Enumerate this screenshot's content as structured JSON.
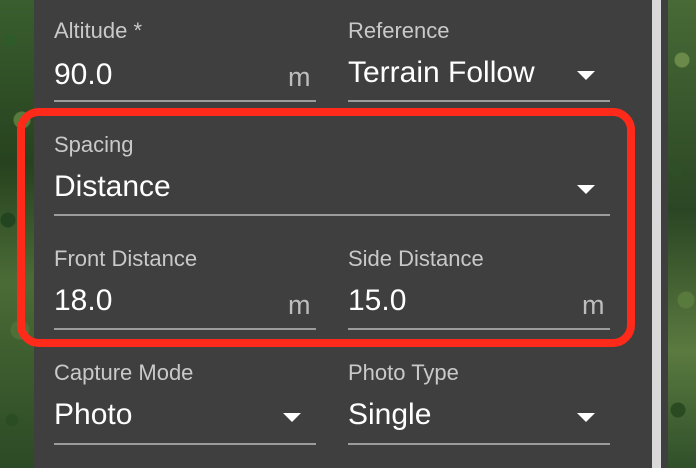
{
  "form": {
    "altitude": {
      "label": "Altitude *",
      "value": "90.0",
      "unit": "m"
    },
    "reference": {
      "label": "Reference",
      "value": "Terrain Follow"
    },
    "spacing": {
      "label": "Spacing",
      "value": "Distance"
    },
    "front_distance": {
      "label": "Front Distance",
      "value": "18.0",
      "unit": "m"
    },
    "side_distance": {
      "label": "Side Distance",
      "value": "15.0",
      "unit": "m"
    },
    "capture_mode": {
      "label": "Capture Mode",
      "value": "Photo"
    },
    "photo_type": {
      "label": "Photo Type",
      "value": "Single"
    }
  },
  "icons": {
    "dropdown": "chevron-down-icon"
  },
  "colors": {
    "panel_bg": "#3f3f3f",
    "highlight": "#ff2a1a",
    "text": "#ffffff",
    "label": "#c9c9c9"
  }
}
